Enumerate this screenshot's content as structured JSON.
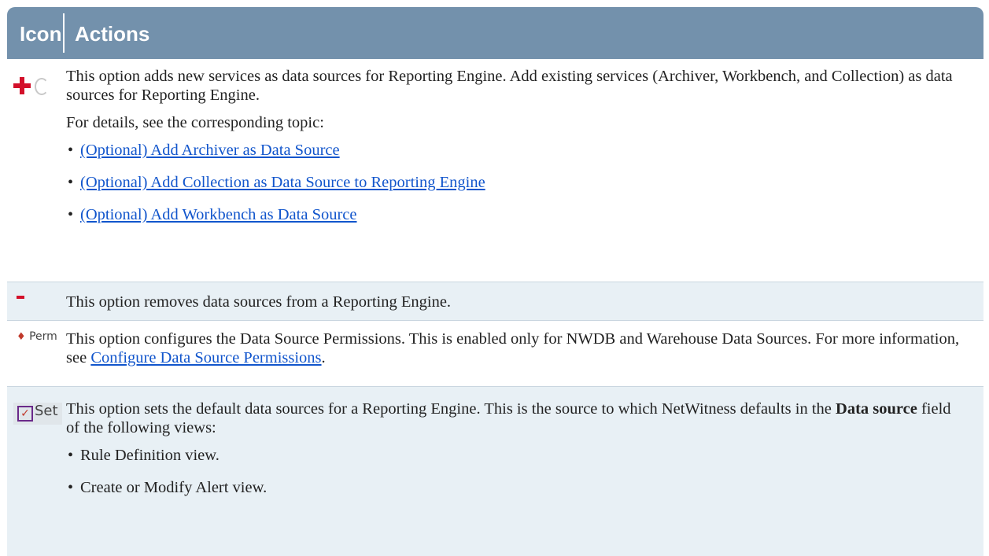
{
  "header": {
    "col_icon": "Icon",
    "col_actions": "Actions"
  },
  "rows": [
    {
      "icon": "add-plus-icon",
      "paragraphs": [
        "This option adds new services as data sources for Reporting Engine. Add existing services (Archiver, Workbench, and Collection) as data sources for Reporting Engine.",
        "For details, see the corresponding topic:"
      ],
      "links": [
        "(Optional) Add Archiver as Data Source",
        "(Optional) Add Collection as Data Source to Reporting Engine",
        "(Optional) Add Workbench as Data Source"
      ]
    },
    {
      "icon": "remove-minus-icon",
      "text": "This option removes data sources from a Reporting Engine."
    },
    {
      "icon": "permissions-icon",
      "icon_label": "Perm",
      "text_before": "This option configures the Data Source Permissions. This is enabled only for NWDB and Warehouse Data Sources. For more information, see ",
      "link": "Configure Data Source Permissions",
      "text_after": "."
    },
    {
      "icon": "set-default-checkbox-icon",
      "icon_label": "Set",
      "text_before": "This option sets the default data sources for a Reporting Engine. This is the source to which NetWitness defaults in the ",
      "bold": "Data source",
      "text_after": " field of the following views:",
      "bullets": [
        "Rule Definition view.",
        "Create or Modify Alert view."
      ]
    }
  ],
  "colors": {
    "header_bg": "#7391ac",
    "row_alt_bg": "#e8f0f5",
    "link": "#1155cc",
    "icon_red": "#d3102a"
  }
}
